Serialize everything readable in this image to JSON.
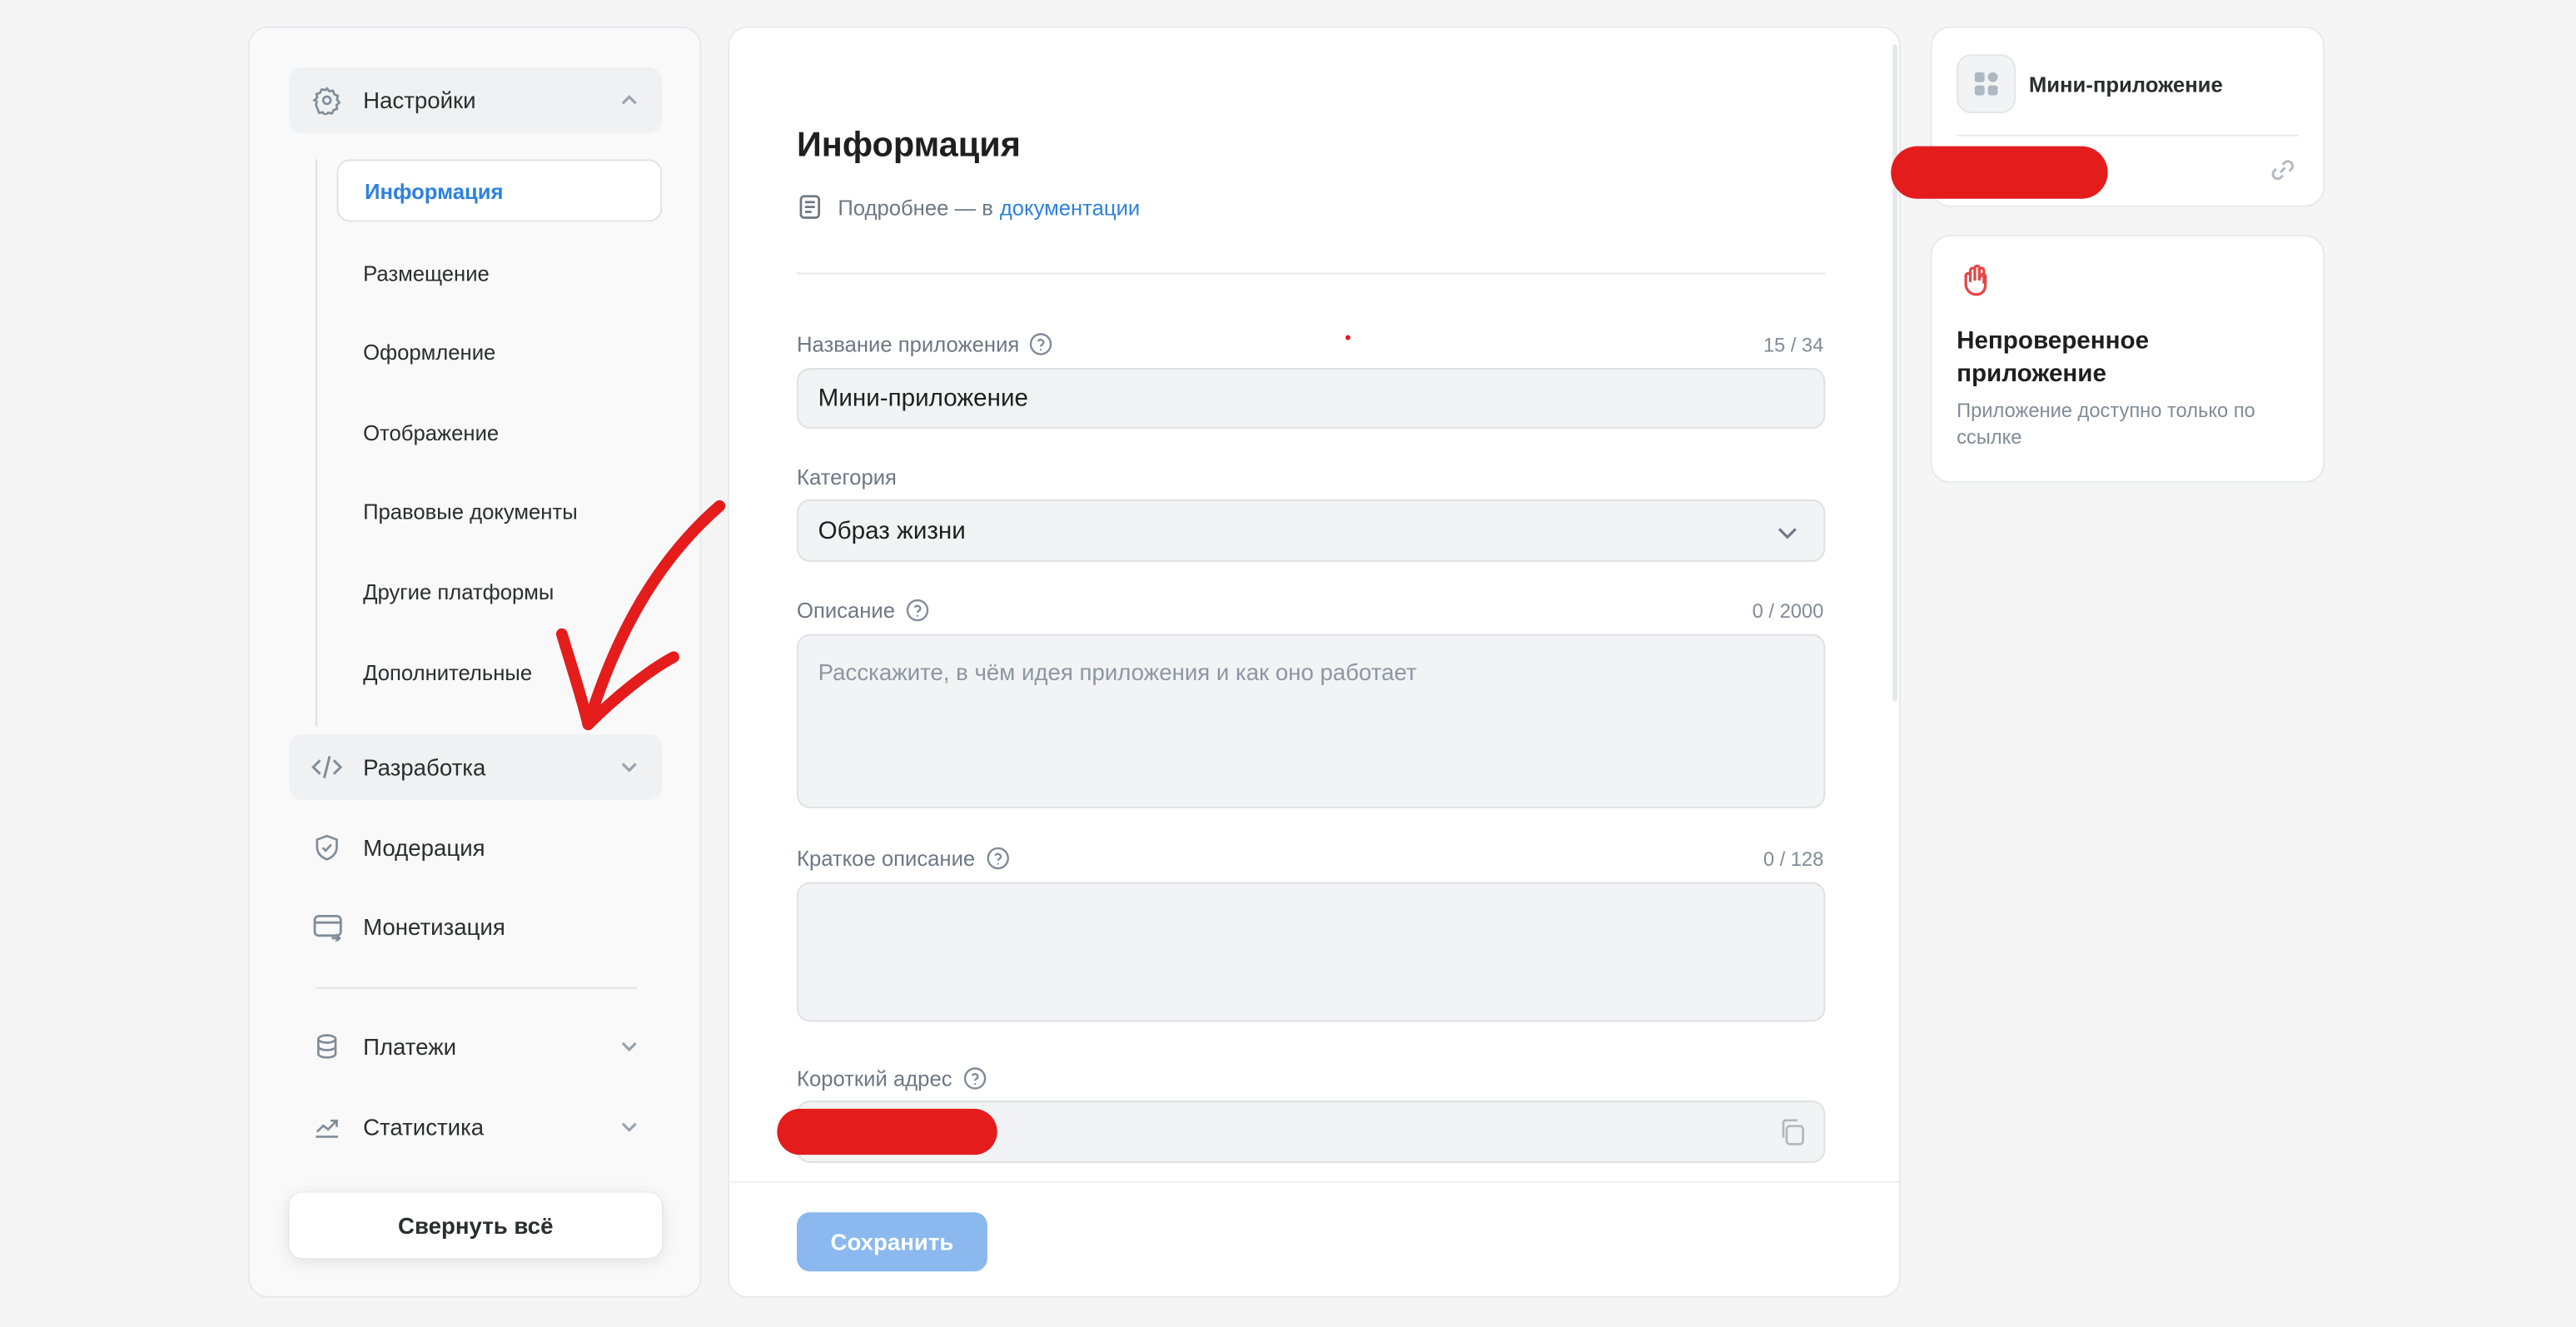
{
  "sidebar": {
    "settings_group": {
      "label": "Настройки"
    },
    "settings_items": [
      {
        "label": "Информация",
        "selected": true
      },
      {
        "label": "Размещение"
      },
      {
        "label": "Оформление"
      },
      {
        "label": "Отображение"
      },
      {
        "label": "Правовые документы"
      },
      {
        "label": "Другие платформы"
      },
      {
        "label": "Дополнительные"
      }
    ],
    "dev_group": {
      "label": "Разработка"
    },
    "moderation": {
      "label": "Модерация"
    },
    "monetization": {
      "label": "Монетизация"
    },
    "payments": {
      "label": "Платежи"
    },
    "statistics": {
      "label": "Статистика"
    },
    "collapse_all": "Свернуть всё"
  },
  "main": {
    "title": "Информация",
    "doc_prefix": "Подробнее — в",
    "doc_link": "документации",
    "fields": {
      "app_name": {
        "label": "Название приложения",
        "counter": "15 / 34",
        "value": "Мини-приложение"
      },
      "category": {
        "label": "Категория",
        "value": "Образ жизни"
      },
      "description": {
        "label": "Описание",
        "counter": "0 / 2000",
        "placeholder": "Расскажите, в чём идея приложения и как оно работает"
      },
      "short_description": {
        "label": "Краткое описание",
        "counter": "0 / 128",
        "placeholder": ""
      },
      "short_address": {
        "label": "Короткий адрес"
      }
    },
    "save_button": "Сохранить"
  },
  "right": {
    "app_card": {
      "name": "Мини-приложение"
    },
    "status_card": {
      "title": "Непроверенное приложение",
      "subtitle": "Приложение доступно только по ссылке"
    }
  },
  "colors": {
    "accent": "#2d81e0",
    "save_disabled": "#8ab8ef",
    "annotation_red": "#e41c1c",
    "status_red": "#e64646"
  }
}
